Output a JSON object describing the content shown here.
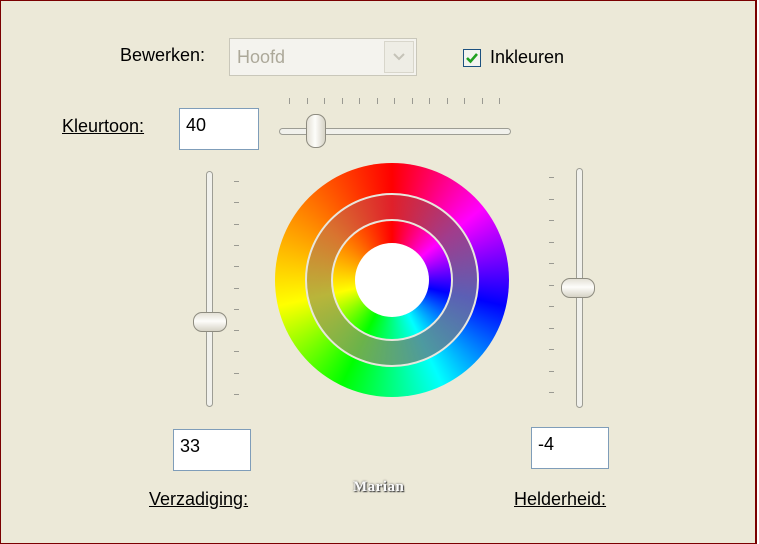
{
  "edit": {
    "label": "Bewerken:",
    "value": "Hoofd"
  },
  "colorize": {
    "label": "Inkleuren",
    "checked": true
  },
  "hue": {
    "label": "Kleurtoon:",
    "value": "40",
    "slider_level": 0.12
  },
  "saturation": {
    "label": "Verzadiging:",
    "value": "33",
    "slider_level": 0.64
  },
  "lightness": {
    "label": "Helderheid:",
    "value": "-4",
    "slider_level": 0.49
  },
  "watermark": "Marian",
  "colors": {
    "dialog_bg": "#ece9d8",
    "check_green": "#21a121",
    "input_border": "#7f9db9",
    "frame_border": "#7a0000"
  }
}
